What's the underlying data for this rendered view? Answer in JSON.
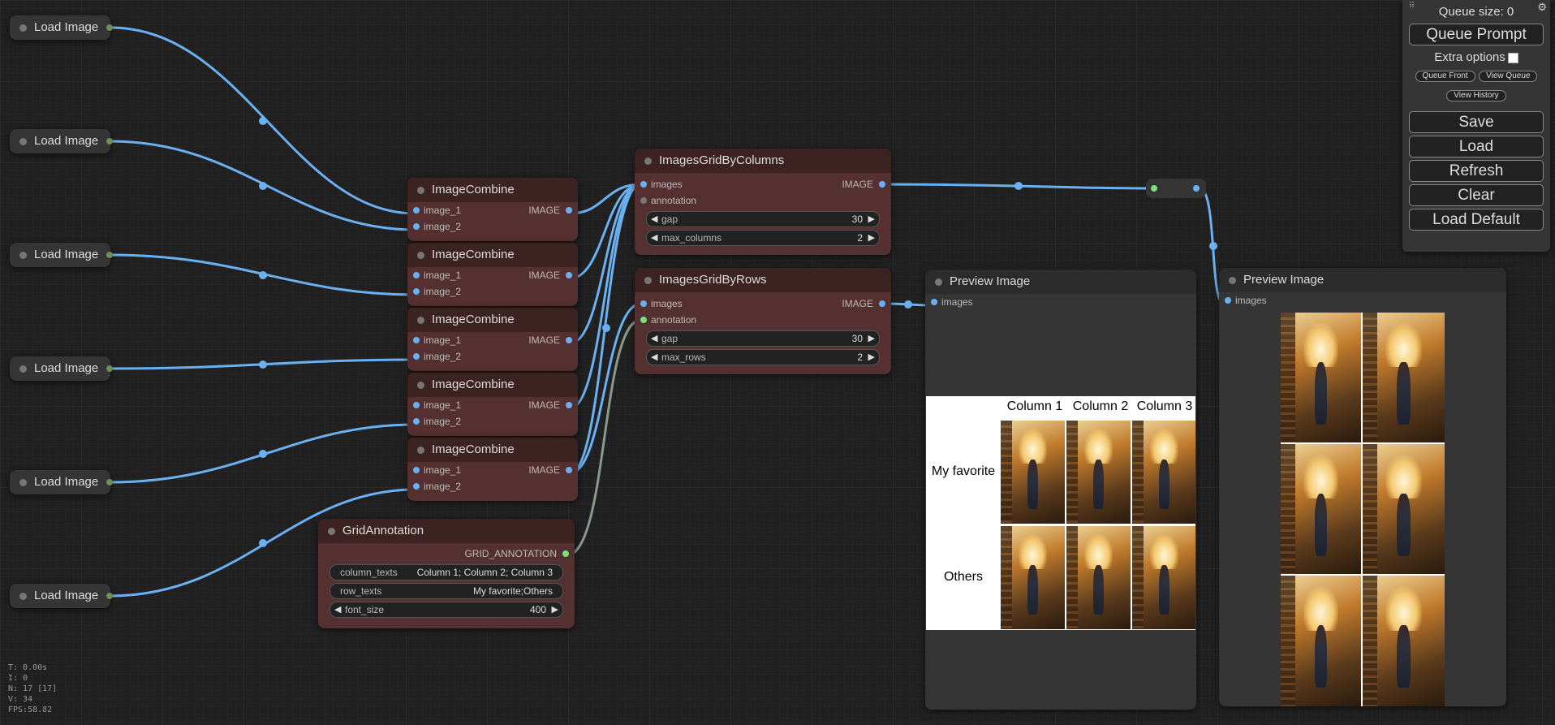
{
  "load_image_nodes": [
    "Load Image",
    "Load Image",
    "Load Image",
    "Load Image",
    "Load Image",
    "Load Image"
  ],
  "image_combine": {
    "title": "ImageCombine",
    "input_1": "image_1",
    "input_2": "image_2",
    "output": "IMAGE"
  },
  "grid_by_columns": {
    "title": "ImagesGridByColumns",
    "in_images": "images",
    "in_annotation": "annotation",
    "output": "IMAGE",
    "gap_label": "gap",
    "gap_value": "30",
    "max_label": "max_columns",
    "max_value": "2"
  },
  "grid_by_rows": {
    "title": "ImagesGridByRows",
    "in_images": "images",
    "in_annotation": "annotation",
    "output": "IMAGE",
    "gap_label": "gap",
    "gap_value": "30",
    "max_label": "max_rows",
    "max_value": "2"
  },
  "grid_annotation": {
    "title": "GridAnnotation",
    "output": "GRID_ANNOTATION",
    "column_texts_label": "column_texts",
    "column_texts_value": "Column 1; Column 2; Column 3",
    "row_texts_label": "row_texts",
    "row_texts_value": "My favorite;Others",
    "font_size_label": "font_size",
    "font_size_value": "400"
  },
  "preview_1": {
    "title": "Preview Image",
    "input": "images",
    "columns": [
      "Column 1",
      "Column 2",
      "Column 3"
    ],
    "rows": [
      "My favorite",
      "Others"
    ]
  },
  "preview_2": {
    "title": "Preview Image",
    "input": "images"
  },
  "panel": {
    "queue_size": "Queue size: 0",
    "queue_prompt": "Queue Prompt",
    "extra_options": "Extra options",
    "queue_front": "Queue Front",
    "view_queue": "View Queue",
    "view_history": "View History",
    "save": "Save",
    "load": "Load",
    "refresh": "Refresh",
    "clear": "Clear",
    "load_default": "Load Default"
  },
  "stats": [
    "T: 0.00s",
    "I: 0",
    "N: 17 [17]",
    "V: 34",
    "FPS:58.82"
  ],
  "icons": {
    "gear": "gear-icon",
    "grip": "drag-handle-icon"
  },
  "colors": {
    "image_link": "#6bb0f0",
    "annotation_link": "#7de07a",
    "node_red": "#553030",
    "canvas": "#202020"
  }
}
